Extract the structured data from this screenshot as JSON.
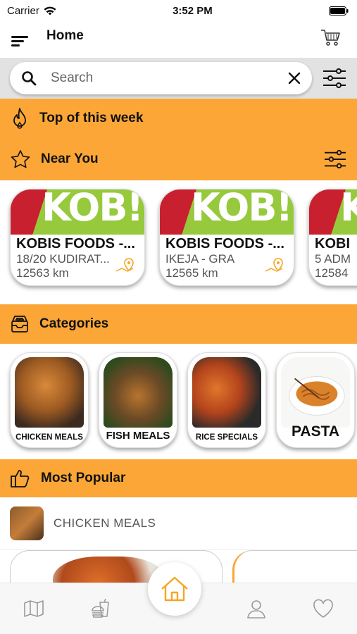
{
  "status_bar": {
    "carrier": "Carrier",
    "time": "3:52 PM"
  },
  "header": {
    "title": "Home"
  },
  "search": {
    "placeholder": "Search"
  },
  "sections": {
    "top_week": "Top of this week",
    "near_you": "Near You",
    "categories": "Categories",
    "most_popular": "Most Popular"
  },
  "restaurants": [
    {
      "name": "KOBIS FOODS -...",
      "address": "18/20 KUDIRAT...",
      "distance": "12563 km"
    },
    {
      "name": "KOBIS FOODS -...",
      "address": "IKEJA - GRA",
      "distance": "12565 km"
    },
    {
      "name": "KOBI",
      "address": "5 ADM",
      "distance": "12584"
    }
  ],
  "categories": [
    {
      "label": "CHICKEN MEALS"
    },
    {
      "label": "FISH MEALS"
    },
    {
      "label": "RICE SPECIALS"
    },
    {
      "label": "PASTA"
    }
  ],
  "most_popular": {
    "category_label": "CHICKEN MEALS"
  },
  "colors": {
    "accent": "#fba636",
    "icon_gray": "#9a9a9a",
    "pin": "#f5a623"
  }
}
